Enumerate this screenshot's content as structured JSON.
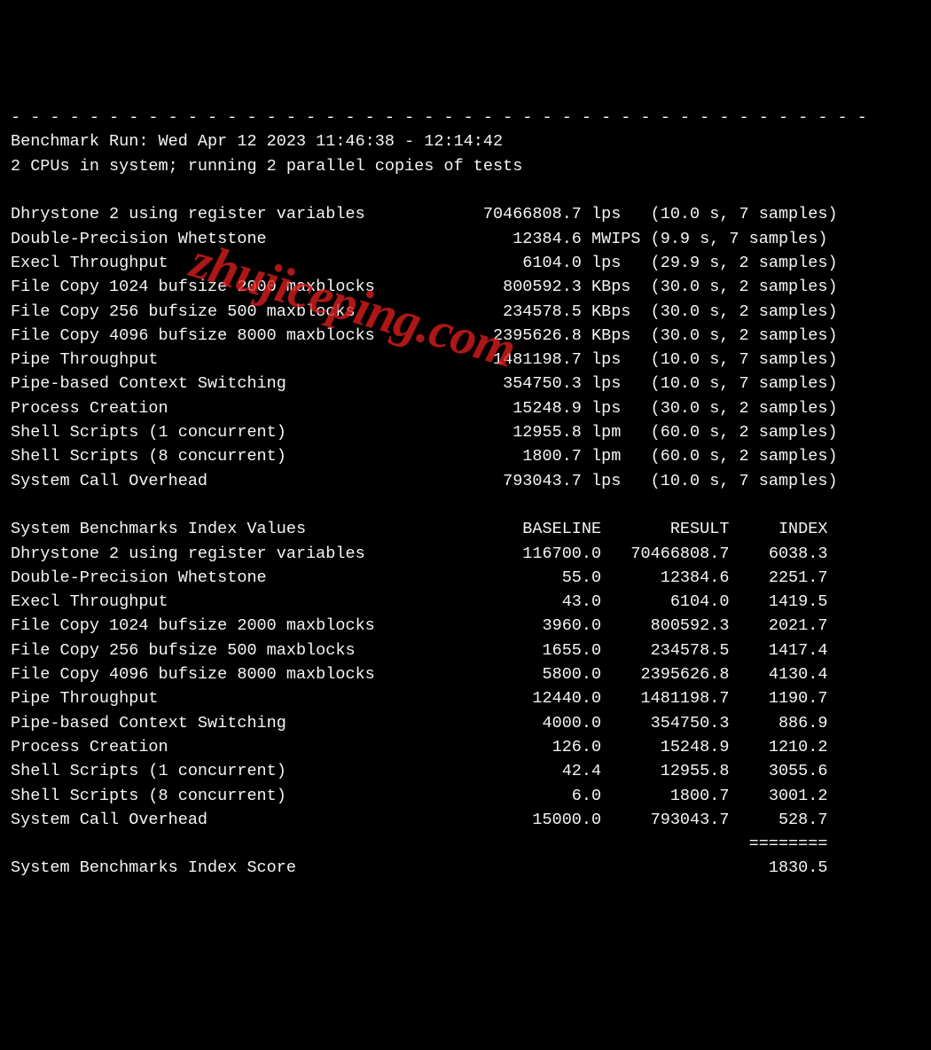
{
  "separator_top": "- - - - - - - - - - - - - - - - - - - - - - - - - - - - - - - - - - - - - - - - - - - -",
  "run_info": {
    "line1": "Benchmark Run: Wed Apr 12 2023 11:46:38 - 12:14:42",
    "line2": "2 CPUs in system; running 2 parallel copies of tests"
  },
  "results": [
    {
      "name": "Dhrystone 2 using register variables",
      "value": "70466808.7",
      "unit": "lps",
      "time": "(10.0 s, 7 samples)"
    },
    {
      "name": "Double-Precision Whetstone",
      "value": "12384.6",
      "unit": "MWIPS",
      "time": "(9.9 s, 7 samples)"
    },
    {
      "name": "Execl Throughput",
      "value": "6104.0",
      "unit": "lps",
      "time": "(29.9 s, 2 samples)"
    },
    {
      "name": "File Copy 1024 bufsize 2000 maxblocks",
      "value": "800592.3",
      "unit": "KBps",
      "time": "(30.0 s, 2 samples)"
    },
    {
      "name": "File Copy 256 bufsize 500 maxblocks",
      "value": "234578.5",
      "unit": "KBps",
      "time": "(30.0 s, 2 samples)"
    },
    {
      "name": "File Copy 4096 bufsize 8000 maxblocks",
      "value": "2395626.8",
      "unit": "KBps",
      "time": "(30.0 s, 2 samples)"
    },
    {
      "name": "Pipe Throughput",
      "value": "1481198.7",
      "unit": "lps",
      "time": "(10.0 s, 7 samples)"
    },
    {
      "name": "Pipe-based Context Switching",
      "value": "354750.3",
      "unit": "lps",
      "time": "(10.0 s, 7 samples)"
    },
    {
      "name": "Process Creation",
      "value": "15248.9",
      "unit": "lps",
      "time": "(30.0 s, 2 samples)"
    },
    {
      "name": "Shell Scripts (1 concurrent)",
      "value": "12955.8",
      "unit": "lpm",
      "time": "(60.0 s, 2 samples)"
    },
    {
      "name": "Shell Scripts (8 concurrent)",
      "value": "1800.7",
      "unit": "lpm",
      "time": "(60.0 s, 2 samples)"
    },
    {
      "name": "System Call Overhead",
      "value": "793043.7",
      "unit": "lps",
      "time": "(10.0 s, 7 samples)"
    }
  ],
  "index_header": {
    "title": "System Benchmarks Index Values",
    "col1": "BASELINE",
    "col2": "RESULT",
    "col3": "INDEX"
  },
  "index_rows": [
    {
      "name": "Dhrystone 2 using register variables",
      "baseline": "116700.0",
      "result": "70466808.7",
      "index": "6038.3"
    },
    {
      "name": "Double-Precision Whetstone",
      "baseline": "55.0",
      "result": "12384.6",
      "index": "2251.7"
    },
    {
      "name": "Execl Throughput",
      "baseline": "43.0",
      "result": "6104.0",
      "index": "1419.5"
    },
    {
      "name": "File Copy 1024 bufsize 2000 maxblocks",
      "baseline": "3960.0",
      "result": "800592.3",
      "index": "2021.7"
    },
    {
      "name": "File Copy 256 bufsize 500 maxblocks",
      "baseline": "1655.0",
      "result": "234578.5",
      "index": "1417.4"
    },
    {
      "name": "File Copy 4096 bufsize 8000 maxblocks",
      "baseline": "5800.0",
      "result": "2395626.8",
      "index": "4130.4"
    },
    {
      "name": "Pipe Throughput",
      "baseline": "12440.0",
      "result": "1481198.7",
      "index": "1190.7"
    },
    {
      "name": "Pipe-based Context Switching",
      "baseline": "4000.0",
      "result": "354750.3",
      "index": "886.9"
    },
    {
      "name": "Process Creation",
      "baseline": "126.0",
      "result": "15248.9",
      "index": "1210.2"
    },
    {
      "name": "Shell Scripts (1 concurrent)",
      "baseline": "42.4",
      "result": "12955.8",
      "index": "3055.6"
    },
    {
      "name": "Shell Scripts (8 concurrent)",
      "baseline": "6.0",
      "result": "1800.7",
      "index": "3001.2"
    },
    {
      "name": "System Call Overhead",
      "baseline": "15000.0",
      "result": "793043.7",
      "index": "528.7"
    }
  ],
  "score_separator": "                                                                                   ========",
  "score": {
    "label": "System Benchmarks Index Score",
    "value": "1830.5"
  },
  "watermark": "zhujiceping.com"
}
